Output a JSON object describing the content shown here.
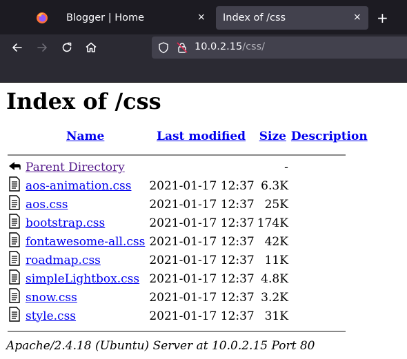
{
  "browser": {
    "tabs": [
      {
        "title": "Blogger | Home",
        "active": false
      },
      {
        "title": "Index of /css",
        "active": true
      }
    ],
    "new_tab_label": "+",
    "close_label": "×",
    "url": {
      "host": "10.0.2.15",
      "path": "/css/"
    },
    "colors": {
      "tabstrip": "#1c1b22",
      "toolbar": "#2b2a33",
      "active_tab": "#42414d",
      "text": "#fbfbfe"
    }
  },
  "page": {
    "title": "Index of /css",
    "columns": {
      "name": "Name",
      "last_modified": "Last modified",
      "size": "Size",
      "description": "Description"
    },
    "parent": {
      "name": "Parent Directory",
      "size": "-"
    },
    "files": [
      {
        "name": "aos-animation.css",
        "modified": "2021-01-17 12:37",
        "size": "6.3K"
      },
      {
        "name": "aos.css",
        "modified": "2021-01-17 12:37",
        "size": "25K"
      },
      {
        "name": "bootstrap.css",
        "modified": "2021-01-17 12:37",
        "size": "174K"
      },
      {
        "name": "fontawesome-all.css",
        "modified": "2021-01-17 12:37",
        "size": "42K"
      },
      {
        "name": "roadmap.css",
        "modified": "2021-01-17 12:37",
        "size": "11K"
      },
      {
        "name": "simpleLightbox.css",
        "modified": "2021-01-17 12:37",
        "size": "4.8K"
      },
      {
        "name": "snow.css",
        "modified": "2021-01-17 12:37",
        "size": "3.2K"
      },
      {
        "name": "style.css",
        "modified": "2021-01-17 12:37",
        "size": "31K"
      }
    ],
    "server_signature": "Apache/2.4.18 (Ubuntu) Server at 10.0.2.15 Port 80"
  }
}
